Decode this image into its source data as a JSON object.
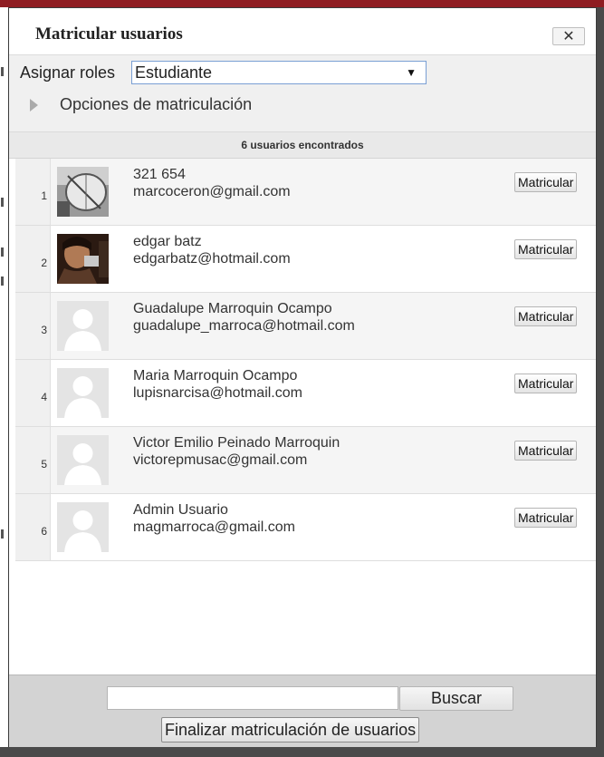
{
  "dialog": {
    "title": "Matricular usuarios",
    "close_icon": "close-icon",
    "close_glyph": "✕"
  },
  "options": {
    "roles_label": "Asignar roles",
    "role_selected": "Estudiante",
    "dropdown_glyph": "▼",
    "enrol_options_label": "Opciones de matriculación"
  },
  "results": {
    "count_label": "6 usuarios encontrados"
  },
  "users": [
    {
      "index": "1",
      "name": "321 654",
      "email": "marcoceron@gmail.com",
      "avatar": "photo-satellite-dish",
      "button": "Matricular"
    },
    {
      "index": "2",
      "name": "edgar batz",
      "email": "edgarbatz@hotmail.com",
      "avatar": "photo-person",
      "button": "Matricular"
    },
    {
      "index": "3",
      "name": "Guadalupe Marroquin Ocampo",
      "email": "guadalupe_marroca@hotmail.com",
      "avatar": "default-user-icon",
      "button": "Matricular"
    },
    {
      "index": "4",
      "name": "Maria Marroquin Ocampo",
      "email": "lupisnarcisa@hotmail.com",
      "avatar": "default-user-icon",
      "button": "Matricular"
    },
    {
      "index": "5",
      "name": "Victor Emilio Peinado Marroquin",
      "email": "victorepmusac@gmail.com",
      "avatar": "default-user-icon",
      "button": "Matricular"
    },
    {
      "index": "6",
      "name": "Admin Usuario",
      "email": "magmarroca@gmail.com",
      "avatar": "default-user-icon",
      "button": "Matricular"
    }
  ],
  "footer": {
    "search_value": "",
    "search_button": "Buscar",
    "finish_button": "Finalizar matriculación de usuarios"
  },
  "colors": {
    "top_bar": "#8f1d22",
    "options_bg": "#f0f0f0",
    "footer_bg": "#d3d3d3"
  }
}
